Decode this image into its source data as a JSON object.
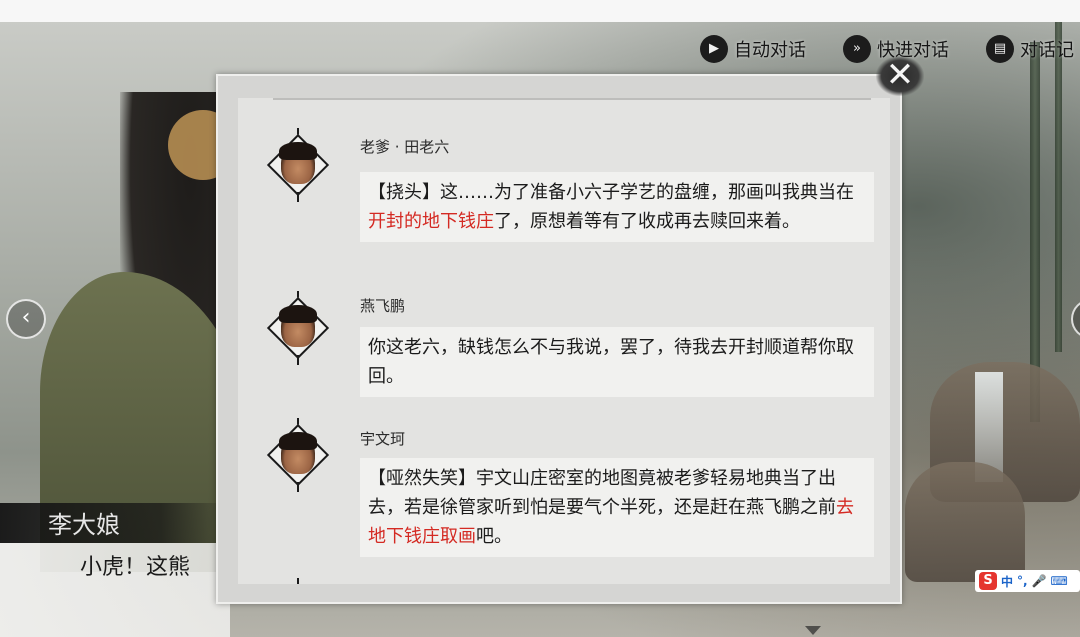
{
  "controls": {
    "auto_label": "自动对话",
    "fast_label": "快进对话",
    "log_label": "对话记"
  },
  "scene": {
    "speaker_name": "李大娘",
    "dialog_line": "小虎！这熊"
  },
  "log": {
    "entries": [
      {
        "name": "老爹 · 田老六",
        "text_parts": [
          "【挠头】这……为了准备小六子学艺的盘缠，那画叫我典当在",
          "开封的地下钱庄",
          "了，原想着等有了收成再去赎回来着。"
        ]
      },
      {
        "name": "燕飞鹏",
        "text_parts": [
          "你这老六，缺钱怎么不与我说，罢了，待我去开封顺道帮你取回。"
        ]
      },
      {
        "name": "宇文珂",
        "text_parts": [
          "【哑然失笑】宇文山庄密室的地图竟被老爹轻易地典当了出去，若是徐管家听到怕是要气个半死，还是赶在燕飞鹏之前",
          "去地下钱庄取画",
          "吧。"
        ]
      }
    ],
    "close_icon": "close-icon"
  },
  "ime": {
    "logo": "S",
    "lang": "中",
    "punct": "°,",
    "mic": "mic-icon",
    "keyboard": "keyboard-icon"
  },
  "colors": {
    "highlight": "#d42a23",
    "panel_bg": "#e3e3e1",
    "bubble_bg": "#f1f1ef"
  }
}
